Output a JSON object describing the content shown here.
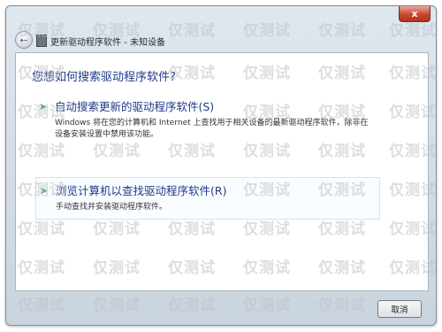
{
  "window": {
    "title": "更新驱动程序软件 - 未知设备",
    "back_icon": "back-arrow-icon",
    "device_icon": "device-icon",
    "close_label": "x"
  },
  "main": {
    "heading": "您想如何搜索驱动程序软件?",
    "options": [
      {
        "title": "自动搜索更新的驱动程序软件(S)",
        "description": "Windows 将在您的计算机和 Internet 上查找用于相关设备的最新驱动程序软件，除非在设备安装设置中禁用该功能。",
        "icon": "green-arrow-icon"
      },
      {
        "title": "浏览计算机以查找驱动程序软件(R)",
        "description": "手动查找并安装驱动程序软件。",
        "icon": "green-arrow-icon"
      }
    ]
  },
  "footer": {
    "cancel_label": "取消"
  },
  "watermark": {
    "text": "仅测试"
  },
  "colors": {
    "link_blue": "#1e3a8a",
    "arrow_green": "#27a33a",
    "close_red": "#c9452f"
  }
}
